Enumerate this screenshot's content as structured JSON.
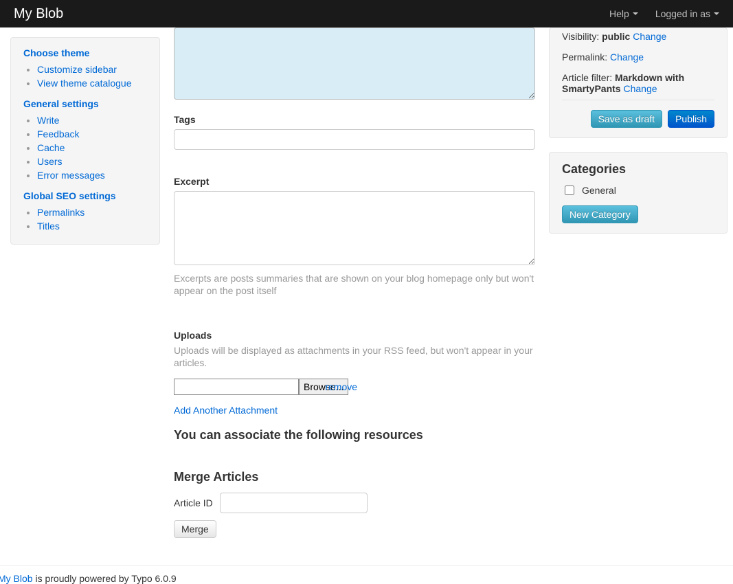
{
  "navbar": {
    "brand": "My Blob",
    "help": "Help",
    "logged_in_as": "Logged in as"
  },
  "sidebar": {
    "headers": {
      "theme": "Choose theme",
      "general": "General settings",
      "seo": "Global SEO settings"
    },
    "theme_items": [
      "Customize sidebar",
      "View theme catalogue"
    ],
    "general_items": [
      "Write",
      "Feedback",
      "Cache",
      "Users",
      "Error messages"
    ],
    "seo_items": [
      "Permalinks",
      "Titles"
    ]
  },
  "center": {
    "tags_label": "Tags",
    "tags_value": "",
    "excerpt_label": "Excerpt",
    "excerpt_value": "",
    "excerpt_help": "Excerpts are posts summaries that are shown on your blog homepage only but won't appear on the post itself",
    "uploads_label": "Uploads",
    "uploads_help": "Uploads will be displayed as attachments in your RSS feed, but won't appear in your articles.",
    "browse_label": "Browse...",
    "remove_label": "remove",
    "add_attachment": "Add Another Attachment",
    "assoc_heading": "You can associate the following resources",
    "merge_heading": "Merge Articles",
    "article_id_label": "Article ID",
    "article_id_value": "",
    "merge_button": "Merge"
  },
  "right": {
    "visibility_label": "Visibility:",
    "visibility_value": "public",
    "permalink_label": "Permalink:",
    "filter_label": "Article filter:",
    "filter_value": "Markdown with SmartyPants",
    "change": "Change",
    "save_draft": "Save as draft",
    "publish": "Publish",
    "categories_heading": "Categories",
    "category_general": "General",
    "new_category": "New Category"
  },
  "footer": {
    "blog_link": "My Blob",
    "rest": " is proudly powered by Typo 6.0.9"
  }
}
